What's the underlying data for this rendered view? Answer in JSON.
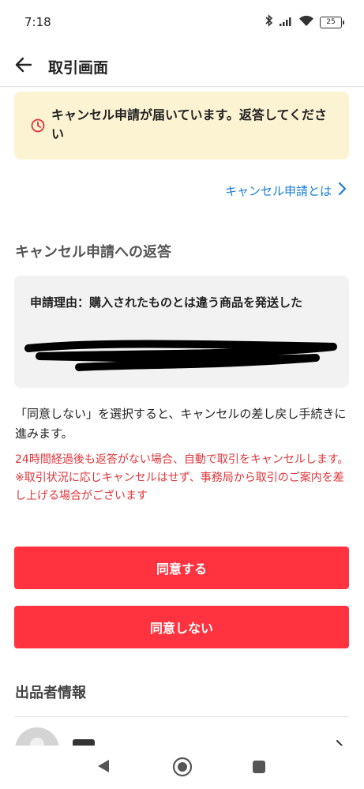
{
  "status_bar": {
    "time": "7:18",
    "battery": "25",
    "icons": [
      "bluetooth-icon",
      "signal-icon",
      "wifi-icon",
      "battery-icon"
    ]
  },
  "header": {
    "title": "取引画面",
    "back_icon": "arrow-left-icon"
  },
  "alert": {
    "icon": "clock-icon",
    "text": "キャンセル申請が届いています。返答してください",
    "background": "#fcf3d3",
    "icon_color": "#e0353b"
  },
  "help_link": {
    "label": "キャンセル申請とは",
    "icon": "chevron-right-icon",
    "color": "#1a7fd4"
  },
  "response_section": {
    "title": "キャンセル申請への返答",
    "reason_text": "申請理由：購入されたものとは違う商品を発送した",
    "note": "「同意しない」を選択すると、キャンセルの差し戻し手続きに進みます。",
    "warning_1": "24時間経過後も返答がない場合、自動で取引をキャンセルします。",
    "warning_2": "※取引状況に応じキャンセルはせず、事務局から取引のご案内を差し上げる場合がございます",
    "warning_color": "#e0353b"
  },
  "buttons": {
    "agree": "同意する",
    "disagree": "同意しない",
    "color": "#ff333f"
  },
  "seller_section": {
    "title": "出品者情報",
    "chevron_icon": "chevron-right-icon"
  },
  "nav_bar": {
    "icons": [
      "nav-back-icon",
      "nav-home-icon",
      "nav-recents-icon"
    ]
  }
}
